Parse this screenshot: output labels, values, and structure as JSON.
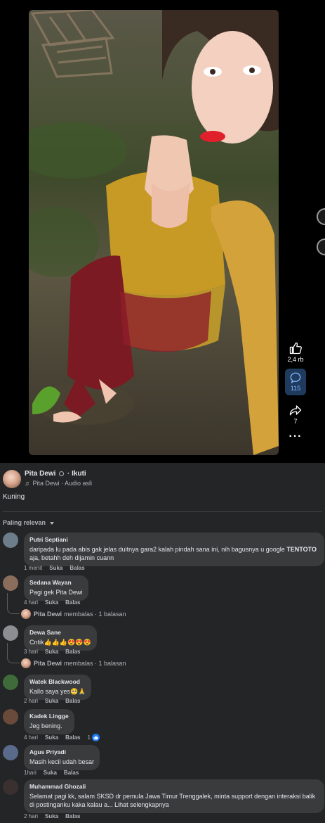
{
  "video": {
    "actions": {
      "like_count": "2,4 rb",
      "comment_count": "115",
      "share_count": "7"
    }
  },
  "post": {
    "author_name": "Pita Dewi",
    "follow_label": "Ikuti",
    "audio_label": "Pita Dewi · Audio asli",
    "caption": "Kuning"
  },
  "comments_section": {
    "sort_label": "Paling relevan",
    "action_like": "Suka",
    "action_reply": "Balas",
    "items": [
      {
        "name": "Putri Septiani",
        "text_before": "daripada lu pada abis gak jelas duitnya gara2 kalah pindah sana ini, nih bagusnya u google ",
        "text_bold": "TENTOTO",
        "text_after": " aja, betahh deh dijamin cuann",
        "time": "1 menit"
      },
      {
        "name": "Sedana Wayan",
        "text": "Pagi gek Pita Dewi",
        "time": "4 hari",
        "reply_name": "Pita Dewi",
        "reply_text": "membalas · 1 balasan"
      },
      {
        "name": "Dewa Sane",
        "text": "Cntik👍👍👍😍😍😍",
        "time": "3 hari",
        "reply_name": "Pita Dewi",
        "reply_text": "membalas · 1 balasan"
      },
      {
        "name": "Watek Blackwood",
        "text": "Kallo saya yes🥺🙏",
        "time": "2 hari"
      },
      {
        "name": "Kadek Lingge",
        "text": "Jeg bening.",
        "time": "4 hari",
        "reactions": "1"
      },
      {
        "name": "Agus Priyadi",
        "text": "Masih kecil udah besar",
        "time": "1hari"
      },
      {
        "name": "Muhammad Ghozali",
        "text": "Selamat pagi kk, salam SKSD dr pemula Jawa Timur Trenggalek, minta support dengan interaksi balik di postinganku kaka kalau a... Lihat selengkapnya",
        "time": "2 hari"
      }
    ]
  }
}
